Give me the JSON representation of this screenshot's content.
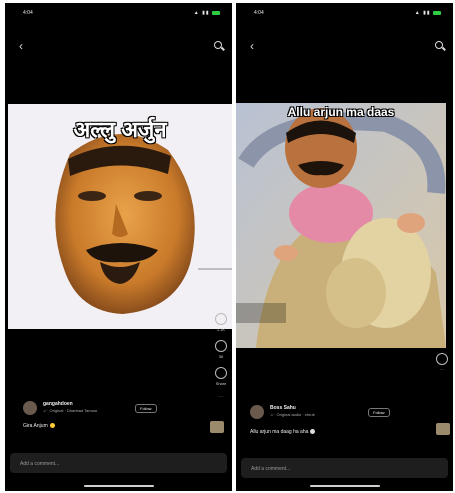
{
  "left": {
    "status": {
      "time": "4:04",
      "icons": "▲ ▮▮"
    },
    "image_caption": "अल्लु अर्जुन",
    "author": {
      "name": "gangahdoen",
      "meta": "♫ · Original · Dhanbad Tamoor",
      "follow": "Follow"
    },
    "caption": "Gira Anjum",
    "rail": {
      "like_count": "1.1K",
      "comment_count": "36",
      "share_count": "Share"
    },
    "comment_placeholder": "Add a comment..."
  },
  "right": {
    "status": {
      "time": "4:04",
      "icons": "▲ ▮▮"
    },
    "image_caption": "Allu arjun ma daas",
    "author": {
      "name": "Boss Sahu",
      "meta": "♫ · Original audio · shruti",
      "follow": "Follow"
    },
    "caption": "Allu arjun ma daag ha aha",
    "comment_placeholder": "Add a comment..."
  },
  "colors": {
    "background": "#000000",
    "like_green": "#2ecc40",
    "emoji_yellow": "#ffcc33"
  }
}
